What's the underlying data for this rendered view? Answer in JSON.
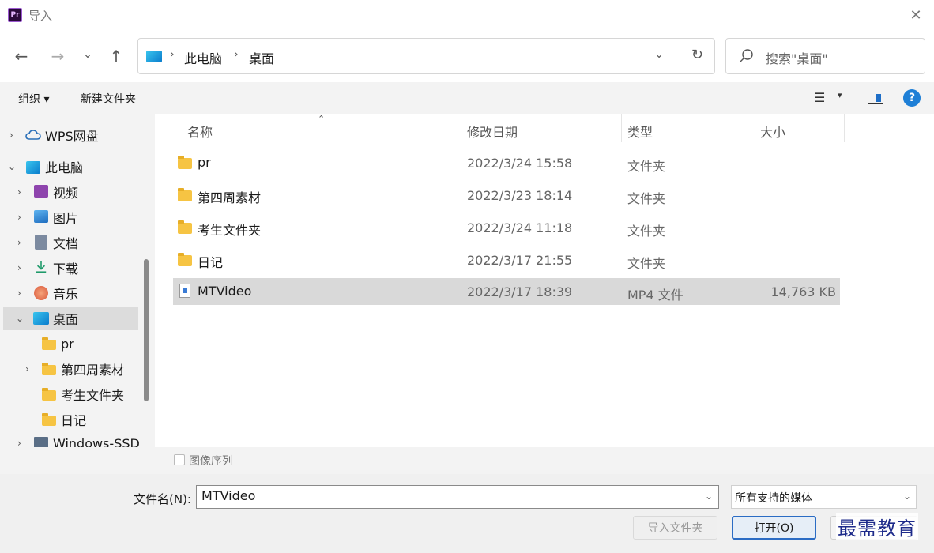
{
  "window": {
    "app_icon_text": "Pr",
    "title": "导入",
    "close_glyph": "✕"
  },
  "nav": {
    "back_glyph": "←",
    "forward_glyph": "→",
    "recent_glyph": "⌄",
    "up_glyph": "↑",
    "breadcrumb": [
      "此电脑",
      "桌面"
    ],
    "separator": "›",
    "dropdown_glyph": "⌄",
    "refresh_glyph": "↻",
    "search_placeholder": "搜索\"桌面\""
  },
  "toolbar": {
    "organize_label": "组织 ▾",
    "new_folder_label": "新建文件夹",
    "view_glyph": "☰",
    "view_dd_glyph": "▾",
    "help_label": "?"
  },
  "tree": {
    "items": [
      {
        "label": "WPS网盘",
        "icon": "cloud-icon"
      },
      {
        "label": "此电脑",
        "icon": "computer-icon"
      },
      {
        "label": "视频",
        "icon": "video-icon"
      },
      {
        "label": "图片",
        "icon": "pictures-icon"
      },
      {
        "label": "文档",
        "icon": "documents-icon"
      },
      {
        "label": "下载",
        "icon": "download-icon"
      },
      {
        "label": "音乐",
        "icon": "music-icon"
      },
      {
        "label": "桌面",
        "icon": "desktop-icon"
      },
      {
        "label": "pr",
        "icon": "folder-icon"
      },
      {
        "label": "第四周素材",
        "icon": "folder-icon"
      },
      {
        "label": "考生文件夹",
        "icon": "folder-icon"
      },
      {
        "label": "日记",
        "icon": "folder-icon"
      },
      {
        "label": "Windows-SSD",
        "icon": "drive-icon"
      }
    ],
    "arrow_right": "›",
    "arrow_down": "⌄"
  },
  "filelist": {
    "columns": {
      "name": "名称",
      "date": "修改日期",
      "type": "类型",
      "size": "大小"
    },
    "sort_glyph": "⌃",
    "rows": [
      {
        "name": "pr",
        "date": "2022/3/24 15:58",
        "type": "文件夹",
        "size": ""
      },
      {
        "name": "第四周素材",
        "date": "2022/3/23 18:14",
        "type": "文件夹",
        "size": ""
      },
      {
        "name": "考生文件夹",
        "date": "2022/3/24 11:18",
        "type": "文件夹",
        "size": ""
      },
      {
        "name": "日记",
        "date": "2022/3/17 21:55",
        "type": "文件夹",
        "size": ""
      },
      {
        "name": "MTVideo",
        "date": "2022/3/17 18:39",
        "type": "MP4 文件",
        "size": "14,763 KB"
      }
    ]
  },
  "sequence": {
    "label": "图像序列"
  },
  "bottom": {
    "filename_label": "文件名(N):",
    "filename_value": "MTVideo",
    "filter_value": "所有支持的媒体",
    "dd_glyph": "⌄",
    "import_folder_label": "导入文件夹",
    "open_label": "打开(O)",
    "watermark": "最需教育"
  }
}
